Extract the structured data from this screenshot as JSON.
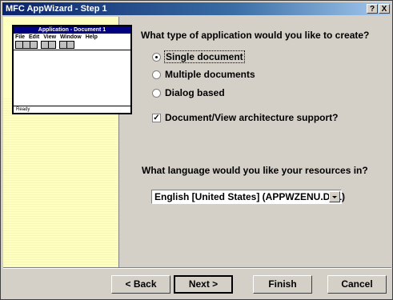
{
  "window": {
    "title": "MFC AppWizard - Step 1",
    "help_glyph": "?",
    "close_glyph": "X"
  },
  "preview": {
    "title": "Application - Document 1",
    "menu": [
      "File",
      "Edit",
      "View",
      "Window",
      "Help"
    ],
    "status": "Ready"
  },
  "question_app_type": "What type of application would you like to create?",
  "app_types": [
    {
      "label": "Single document",
      "checked": true
    },
    {
      "label": "Multiple documents",
      "checked": false
    },
    {
      "label": "Dialog based",
      "checked": false
    }
  ],
  "doc_view_support": {
    "label": "Document/View architecture support?",
    "checked": true,
    "mark": "✓"
  },
  "question_language": "What language would you like your resources in?",
  "language_select": {
    "value": "English [United States] (APPWZENU.DLL)"
  },
  "buttons": {
    "back": "< Back",
    "next": "Next >",
    "finish": "Finish",
    "cancel": "Cancel"
  }
}
